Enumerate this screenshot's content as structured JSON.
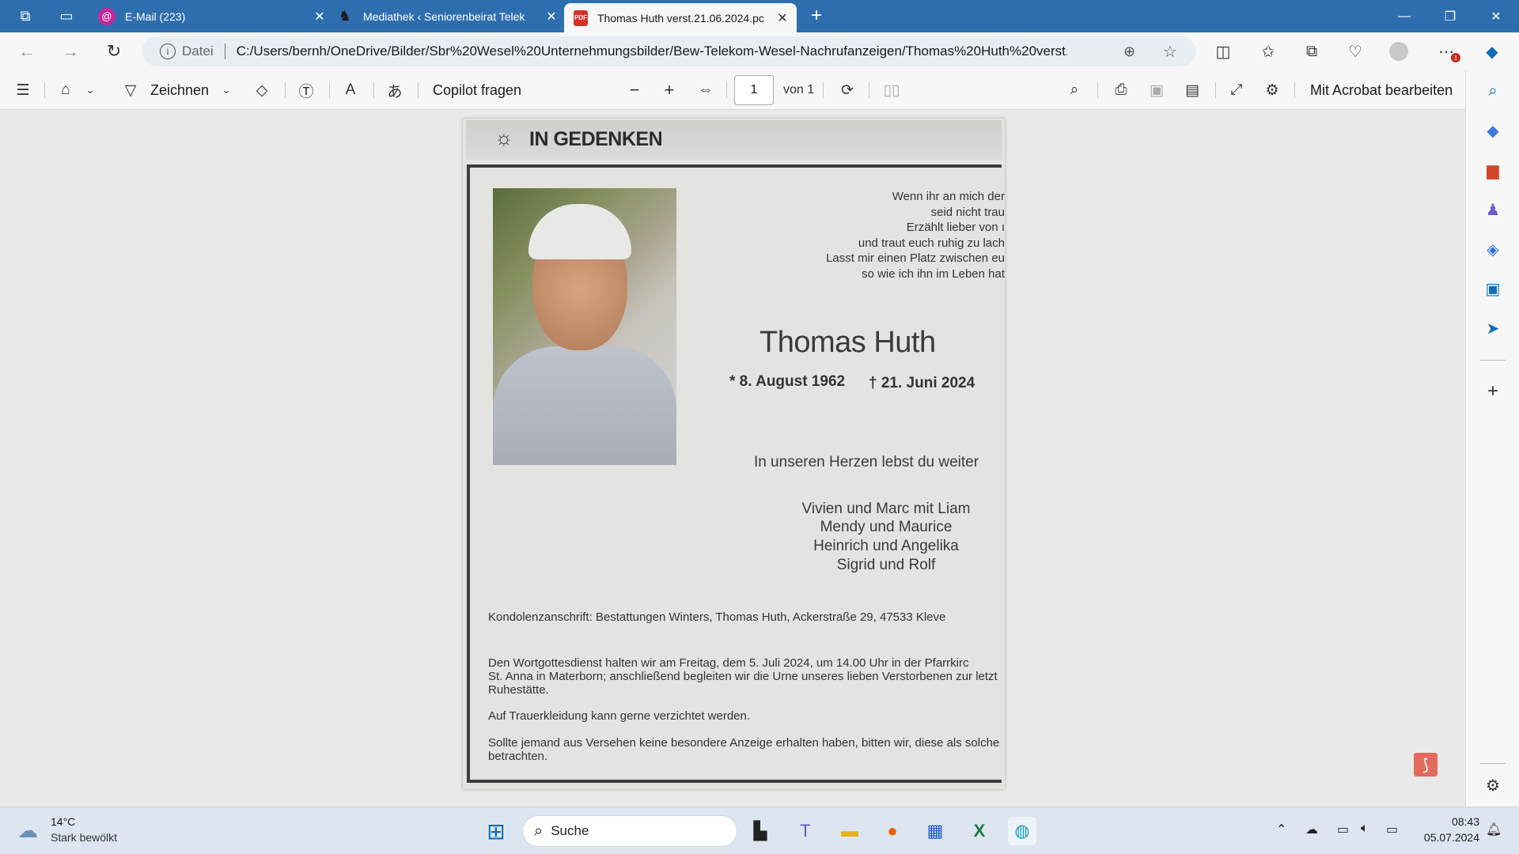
{
  "tabs": [
    {
      "title": "E-Mail (223)",
      "icon": "mail-icon"
    },
    {
      "title": "Mediathek ‹ Seniorenbeirat Telek",
      "icon": "site-icon"
    },
    {
      "title": "Thomas Huth verst.21.06.2024.pc",
      "icon": "pdf-icon"
    }
  ],
  "address": {
    "scheme_label": "Datei",
    "url": "C:/Users/bernh/OneDrive/Bilder/Sbr%20Wesel%20Unternehmungsbilder/Bew-Telekom-Wesel-Nachrufanzeigen/Thomas%20Huth%20verst.2..."
  },
  "pdf_toolbar": {
    "draw_label": "Zeichnen",
    "copilot_label": "Copilot fragen",
    "page_current": "1",
    "page_of": "von 1",
    "acrobat_label": "Mit Acrobat bearbeiten"
  },
  "notice": {
    "header": "IN GEDENKEN",
    "poem": [
      "Wenn ihr an mich der",
      "seid nicht trau",
      "Erzählt lieber von ı",
      "und traut euch ruhig zu lach",
      "Lasst mir einen Platz zwischen eu",
      "so wie ich ihn im Leben hat"
    ],
    "name": "Thomas Huth",
    "birth": "* 8. August 1962",
    "death": "† 21. Juni 2024",
    "motto": "In unseren Herzen lebst du weiter",
    "family": [
      "Vivien und Marc mit Liam",
      "Mendy und Maurice",
      "Heinrich und Angelika",
      "Sigrid und Rolf"
    ],
    "condolence": "Kondolenzanschrift: Bestattungen Winters, Thomas Huth, Ackerstraße 29, 47533 Kleve",
    "service": [
      "Den Wortgottesdienst halten wir am Freitag, dem 5. Juli 2024, um 14.00 Uhr in der Pfarrkirc",
      "St. Anna in Materborn; anschließend begleiten wir die Urne unseres lieben Verstorbenen zur letzt",
      "Ruhestätte."
    ],
    "mourning": "Auf Trauerkleidung kann gerne verzichtet werden.",
    "note": [
      "Sollte jemand aus Versehen keine besondere Anzeige erhalten haben, bitten wir, diese als solche",
      "betrachten."
    ]
  },
  "weather": {
    "temp": "14°C",
    "desc": "Stark bewölkt"
  },
  "taskbar": {
    "search_placeholder": "Suche"
  },
  "clock": {
    "time": "08:43",
    "date": "05.07.2024"
  },
  "colors": {
    "titlebar": "#2f6eae",
    "accent": "#0f6cbd"
  }
}
